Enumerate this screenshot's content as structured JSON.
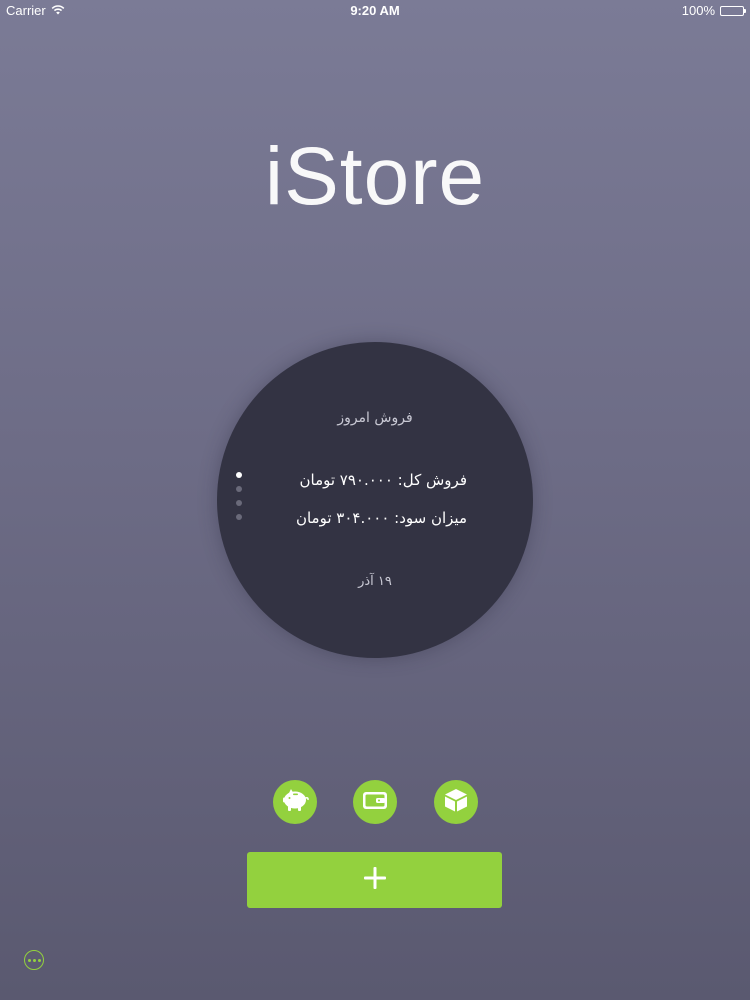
{
  "status_bar": {
    "carrier": "Carrier",
    "time": "9:20 AM",
    "battery": "100%",
    "battery_level": 1.0
  },
  "app": {
    "title": "iStore"
  },
  "sales_card": {
    "heading": "فروش امروز",
    "total_sales": "فروش کل: ۷۹۰.۰۰۰ تومان",
    "profit": "میزان سود: ۳۰۴.۰۰۰ تومان",
    "date": "۱۹ آذر",
    "page_count": 4,
    "active_page": 1
  },
  "actions": {
    "icons": [
      "piggy-bank-icon",
      "wallet-icon",
      "box-icon"
    ],
    "add_icon": "plus-icon",
    "more_icon": "more-icon"
  },
  "colors": {
    "accent": "#93d13e",
    "card": "#333343",
    "background_top": "#7b7b96",
    "background_bottom": "#5a5970"
  }
}
